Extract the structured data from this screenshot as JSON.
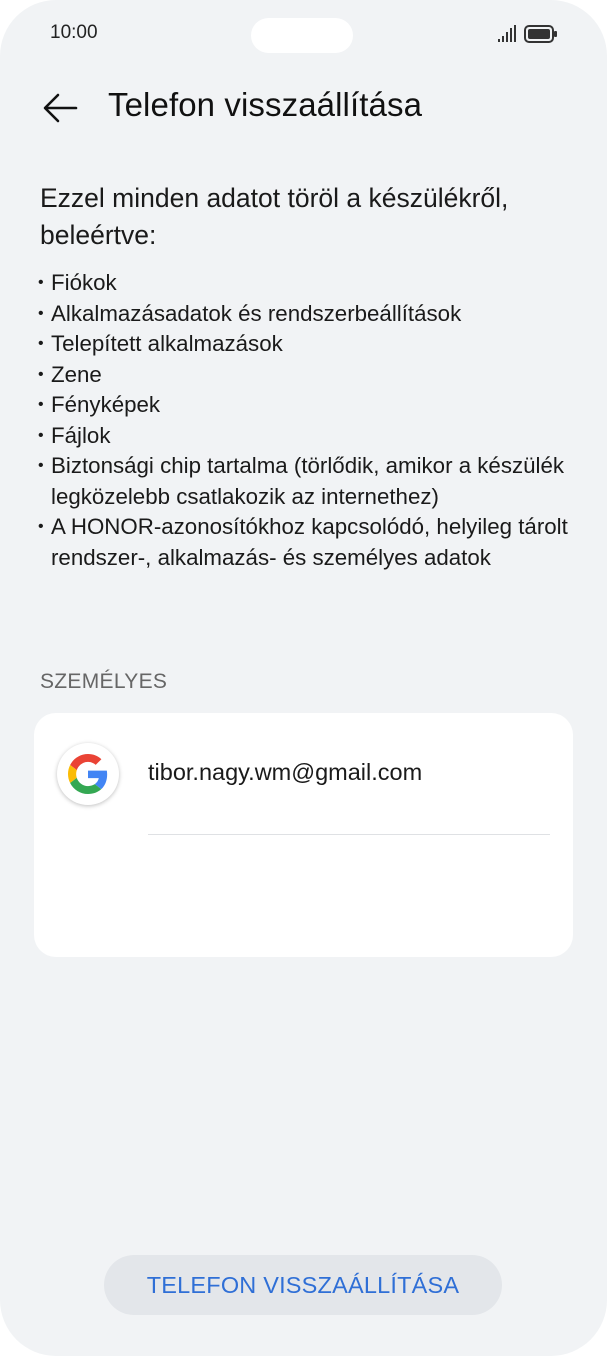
{
  "status_bar": {
    "time": "10:00",
    "icons": [
      "signal-icon",
      "battery-icon"
    ]
  },
  "header": {
    "back_icon": "arrow-left-icon",
    "title": "Telefon visszaállítása"
  },
  "content": {
    "intro": "Ezzel minden adatot töröl a készülékről, beleértve:",
    "items": [
      "Fiókok",
      "Alkalmazásadatok és rendszerbeállítások",
      "Telepített alkalmazások",
      "Zene",
      "Fényképek",
      "Fájlok",
      "Biztonsági chip tartalma (törlődik, amikor a készülék legközelebb csatlakozik az internethez)",
      "A HONOR-azonosítókhoz kapcsolódó, helyileg tárolt rendszer-, alkalmazás- és személyes adatok"
    ]
  },
  "personal_section": {
    "heading": "SZEMÉLYES",
    "accounts": [
      {
        "icon": "google-icon",
        "email": "tibor.nagy.wm@gmail.com"
      }
    ]
  },
  "reset_button": {
    "label": "TELEFON VISSZAÁLLÍTÁSA"
  },
  "colors": {
    "background": "#f1f3f5",
    "accent": "#2f6fd6",
    "card": "#ffffff",
    "button_bg": "#e3e6ea"
  }
}
